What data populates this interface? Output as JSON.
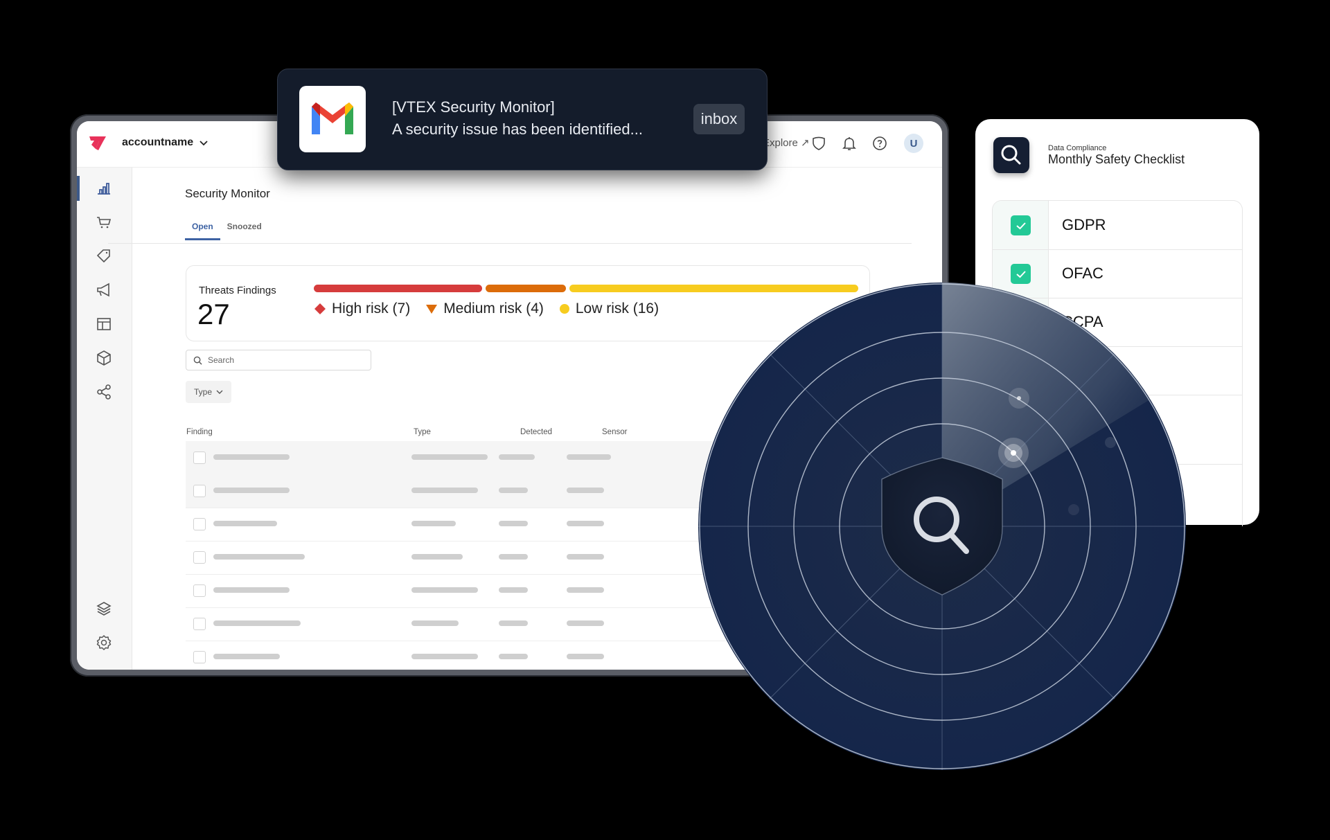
{
  "app": {
    "account_name": "accountname",
    "explore_link": "Explore",
    "avatar_initial": "U"
  },
  "sidebar": {
    "items": [
      {
        "icon": "bar-chart-icon",
        "active": true
      },
      {
        "icon": "cart-icon",
        "active": false
      },
      {
        "icon": "tag-icon",
        "active": false
      },
      {
        "icon": "megaphone-icon",
        "active": false
      },
      {
        "icon": "layout-icon",
        "active": false
      },
      {
        "icon": "box-icon",
        "active": false
      },
      {
        "icon": "share-icon",
        "active": false
      }
    ],
    "bottom_items": [
      {
        "icon": "layers-icon"
      },
      {
        "icon": "gear-icon"
      }
    ]
  },
  "page": {
    "title": "Security Monitor",
    "tabs": [
      {
        "label": "Open",
        "active": true
      },
      {
        "label": "Snoozed",
        "active": false
      }
    ]
  },
  "threats": {
    "label": "Threats Findings",
    "count": "27",
    "segments": [
      {
        "name": "High risk",
        "count": 7,
        "color": "#d63c3c",
        "label": "High risk (7)"
      },
      {
        "name": "Medium risk",
        "count": 4,
        "color": "#dc6c0a",
        "label": "Medium risk (4)"
      },
      {
        "name": "Low risk",
        "count": 16,
        "color": "#f7cc1f",
        "label": "Low risk (16)"
      }
    ]
  },
  "search": {
    "placeholder": "Search"
  },
  "filter": {
    "type_label": "Type"
  },
  "table": {
    "headers": [
      "Finding",
      "Type",
      "Detected",
      "Sensor"
    ],
    "rows": 7
  },
  "notification": {
    "title": "[VTEX Security Monitor]",
    "body": "A security issue has been identified...",
    "action": "inbox"
  },
  "checklist": {
    "subtitle": "Data Compliance",
    "title": "Monthly Safety Checklist",
    "items": [
      {
        "label": "GDPR",
        "checked": true
      },
      {
        "label": "OFAC",
        "checked": true
      },
      {
        "label": "CCPA",
        "checked": false
      },
      {
        "label": "",
        "checked": false
      },
      {
        "label": "",
        "checked": false
      },
      {
        "label": "",
        "checked": false
      }
    ]
  }
}
